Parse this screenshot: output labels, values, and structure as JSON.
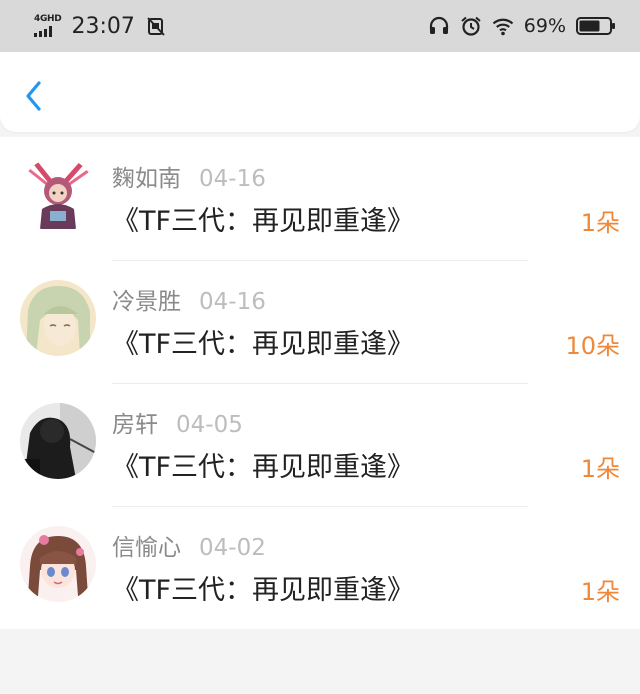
{
  "status_bar": {
    "network": "4GHD",
    "time": "23:07",
    "battery_percent": "69%",
    "battery_level": 0.69,
    "icons": [
      "signal-icon",
      "no-sim-icon",
      "headphones-icon",
      "alarm-icon",
      "wifi-icon",
      "battery-icon"
    ]
  },
  "header": {
    "back_icon": "chevron-left-icon",
    "accent": "#2196f3"
  },
  "rows": [
    {
      "name": "麴如南",
      "date": "04-16",
      "title": "《TF三代：再见即重逢》",
      "count": "1朵"
    },
    {
      "name": "冷景胜",
      "date": "04-16",
      "title": "《TF三代：再见即重逢》",
      "count": "10朵"
    },
    {
      "name": "房轩",
      "date": "04-05",
      "title": "《TF三代：再见即重逢》",
      "count": "1朵"
    },
    {
      "name": "信愉心",
      "date": "04-02",
      "title": "《TF三代：再见即重逢》",
      "count": "1朵"
    }
  ],
  "colors": {
    "count": "#f0883a",
    "name": "#8a8a8a",
    "date": "#bdbdbd",
    "status_bar_bg": "#d9d9d9"
  }
}
